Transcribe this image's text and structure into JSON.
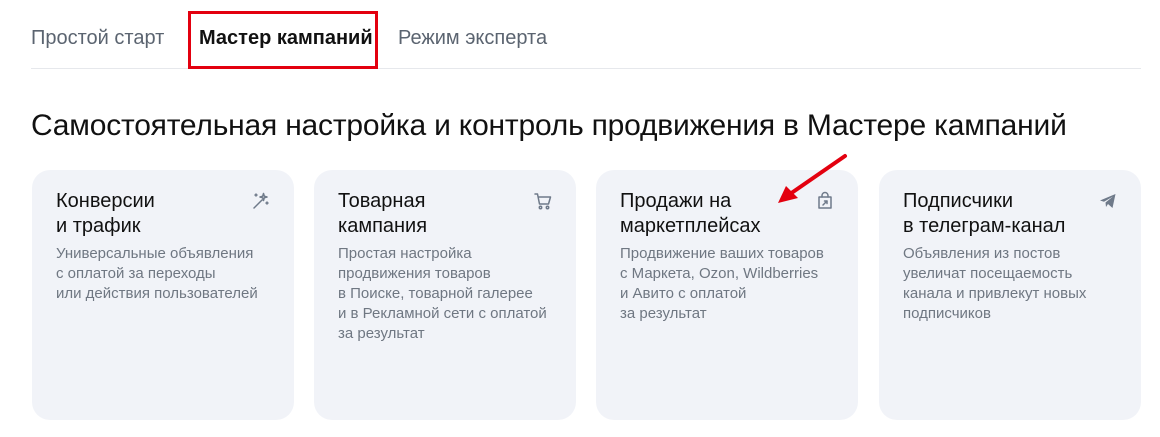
{
  "tabs": [
    {
      "label": "Простой старт",
      "active": false
    },
    {
      "label": "Мастер кампаний",
      "active": true
    },
    {
      "label": "Режим эксперта",
      "active": false
    }
  ],
  "heading": "Самостоятельная настройка и контроль продвижения в Мастере кампаний",
  "cards": [
    {
      "title": "Конверсии\nи трафик",
      "description": "Универсальные объявления\nс оплатой за переходы\nили действия пользователей",
      "icon": "magic-wand-icon"
    },
    {
      "title": "Товарная\nкампания",
      "description": "Простая настройка\nпродвижения товаров\nв Поиске, товарной галерее\nи в Рекламной сети с оплатой\nза результат",
      "icon": "cart-icon"
    },
    {
      "title": "Продажи на\nмаркетплейсах",
      "description": "Продвижение ваших товаров\nс Маркета, Ozon, Wildberries\nи Авито с оплатой\nза результат",
      "icon": "shopping-bag-icon"
    },
    {
      "title": "Подписчики\nв телеграм-канал",
      "description": "Объявления из постов\nувеличат посещаемость\nканала и привлекут новых\nподписчиков",
      "icon": "paper-plane-icon"
    }
  ],
  "colors": {
    "card_background": "#f1f3f8",
    "highlight": "#e3000f",
    "icon": "#6f7a8a"
  }
}
